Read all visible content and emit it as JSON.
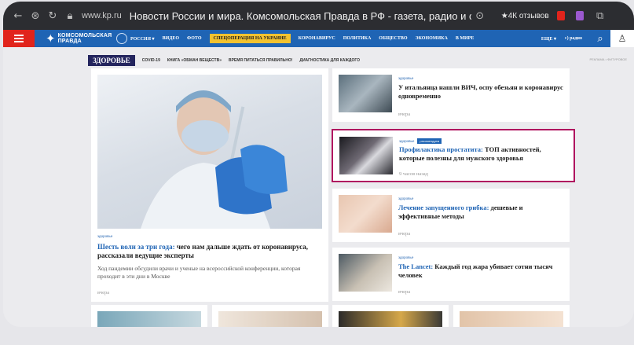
{
  "browser": {
    "url": "www.kp.ru",
    "page_title": "Новости России и мира. Комсомольская Правда в РФ - газета, радио и сайт // W...",
    "reviews": "★4К отзывов"
  },
  "site": {
    "logo_text": [
      "КОМСОМОЛЬСКАЯ",
      "ПРАВДА"
    ],
    "nav": [
      "РОССИЯ ▾",
      "ВИДЕО",
      "ФОТО",
      "СПЕЦОПЕРАЦИЯ НА УКРАИНЕ",
      "КОРОНАВИРУС",
      "ПОЛИТИКА",
      "ОБЩЕСТВО",
      "ЭКОНОМИКА",
      "В МИРЕ"
    ],
    "more": "ЕЩЕ ▾",
    "radio": "радио"
  },
  "section": {
    "label": "ЗДОРОВЬЕ",
    "links": [
      "COVID-19",
      "КНИГА «ОБМАН ВЕЩЕСТВ»",
      "ВРЕМЯ ПИТАТЬСЯ ПРАВИЛЬНО!",
      "ДИАГНОСТИКА ДЛЯ КАЖДОГО"
    ],
    "ad": "РЕКЛАМА • ФИТУРОВОЕ"
  },
  "main_article": {
    "tag": "здоровье",
    "title_link": "Шесть волн за три года:",
    "title_rest": " чего нам дальше ждать от коронавируса, рассказали ведущие эксперты",
    "subtitle": "Ход пандемии обсудили врачи и ученые на всероссийской конференции, которая проходит в эти дни в Москве",
    "time": "вчера"
  },
  "side_articles": [
    {
      "tag": "здоровье",
      "title_link": "",
      "title_rest": "У итальянца нашли ВИЧ, оспу обезьян и коронавирус одновременно",
      "time": "вчера"
    },
    {
      "tag": "здоровье",
      "badge": "рекомендуем",
      "title_link": "Профилактика простатита:",
      "title_rest": " ТОП активностей, которые полезны для мужского здоровья",
      "time": "9 часов назад"
    },
    {
      "tag": "здоровье",
      "title_link": "Лечение запущенного грибка:",
      "title_rest": " дешевые и эффективные методы",
      "time": "вчера"
    },
    {
      "tag": "здоровье",
      "title_link": "The Lancet:",
      "title_rest": " Каждый год жара убивает сотни тысяч человек",
      "time": "вчера"
    }
  ],
  "colors": {
    "brand_blue": "#1f64b4",
    "brand_red": "#e1241c",
    "highlight": "#b0145f",
    "section_dark": "#24255e"
  }
}
